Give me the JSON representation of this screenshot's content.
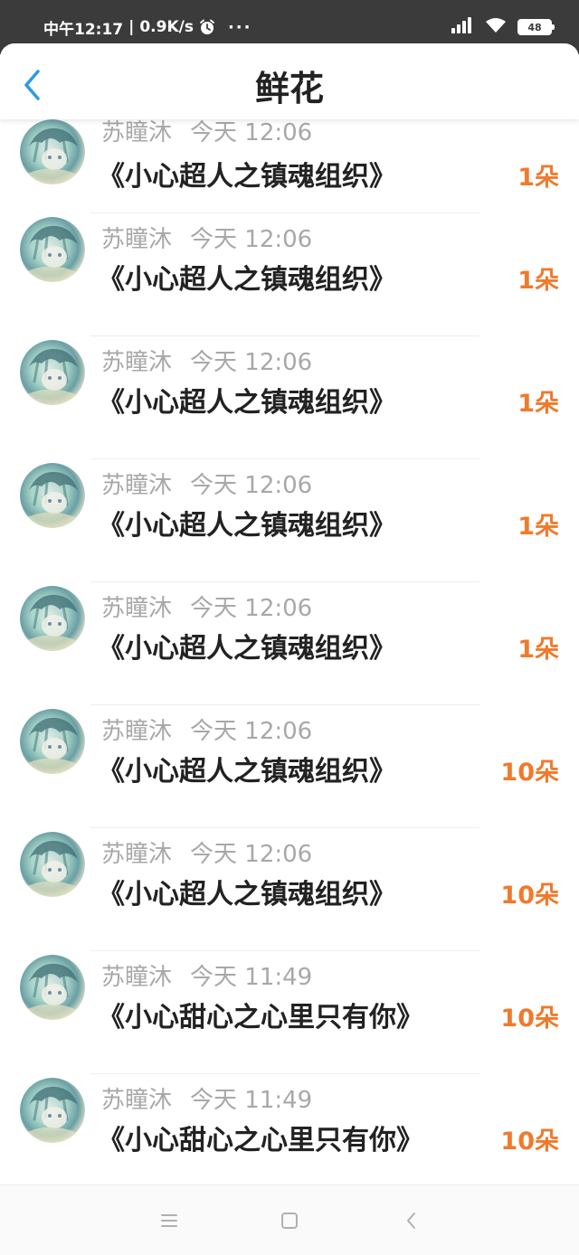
{
  "status_bar": {
    "time": "中午12:17",
    "separator": "|",
    "speed": "0.9K/s",
    "more": "···",
    "battery": "48",
    "icons": [
      "alarm-icon",
      "signal-icon",
      "wifi-icon",
      "battery-icon"
    ]
  },
  "header": {
    "title": "鲜花",
    "back_icon": "chevron-left-icon",
    "accent_color": "#2b9be6"
  },
  "items": [
    {
      "name": "苏瞳沐",
      "time": "今天 12:06",
      "title": "《小心超人之镇魂组织》",
      "count": "1朵"
    },
    {
      "name": "苏瞳沐",
      "time": "今天 12:06",
      "title": "《小心超人之镇魂组织》",
      "count": "1朵"
    },
    {
      "name": "苏瞳沐",
      "time": "今天 12:06",
      "title": "《小心超人之镇魂组织》",
      "count": "1朵"
    },
    {
      "name": "苏瞳沐",
      "time": "今天 12:06",
      "title": "《小心超人之镇魂组织》",
      "count": "1朵"
    },
    {
      "name": "苏瞳沐",
      "time": "今天 12:06",
      "title": "《小心超人之镇魂组织》",
      "count": "1朵"
    },
    {
      "name": "苏瞳沐",
      "time": "今天 12:06",
      "title": "《小心超人之镇魂组织》",
      "count": "10朵"
    },
    {
      "name": "苏瞳沐",
      "time": "今天 12:06",
      "title": "《小心超人之镇魂组织》",
      "count": "10朵"
    },
    {
      "name": "苏瞳沐",
      "time": "今天 11:49",
      "title": "《小心甜心之心里只有你》",
      "count": "10朵"
    },
    {
      "name": "苏瞳沐",
      "time": "今天 11:49",
      "title": "《小心甜心之心里只有你》",
      "count": "10朵"
    }
  ],
  "colors": {
    "count": "#f07a2c",
    "meta": "#a8a8a8",
    "title": "#222222",
    "statusbar": "#3b3b3b"
  },
  "nav_bar": {
    "icons": [
      "menu-icon",
      "home-icon",
      "back-icon"
    ]
  }
}
